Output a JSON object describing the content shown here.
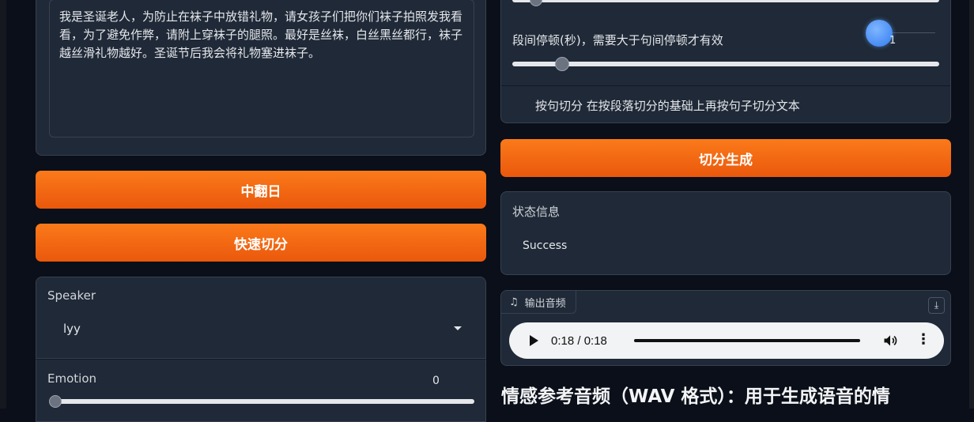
{
  "input_text": "我是圣诞老人，为防止在袜子中放错礼物，请女孩子们把你们袜子拍照发我看看，为了避免作弊，请附上穿袜子的腿照。最好是丝袜，白丝黑丝都行，袜子越丝滑礼物越好。圣诞节后我会将礼物塞进袜子。",
  "buttons": {
    "translate": "中翻日",
    "quick_split": "快速切分",
    "split_generate": "切分生成"
  },
  "speaker": {
    "label": "Speaker",
    "value": "lyy"
  },
  "emotion": {
    "label": "Emotion",
    "value": "0"
  },
  "settings": {
    "paragraph_pause_label": "段间停顿(秒)，需要大于句间停顿才有效",
    "paragraph_pause_value": "1",
    "sentence_split_label": "按句切分 在按段落切分的基础上再按句子切分文本"
  },
  "status": {
    "label": "状态信息",
    "text": "Success"
  },
  "audio": {
    "tab_label": "输出音频",
    "time": "0:18 / 0:18",
    "progress": 1.0,
    "icons": [
      "music-note-icon",
      "download-icon",
      "play-icon",
      "volume-icon",
      "more-options-icon"
    ]
  },
  "emotion_reference_heading": "情感参考音频（WAV 格式）：用于生成语音的情",
  "colors": {
    "accent": "#f97316",
    "panel": "#1f2937",
    "background": "#0b0f19",
    "knob": "#3b82f6"
  }
}
